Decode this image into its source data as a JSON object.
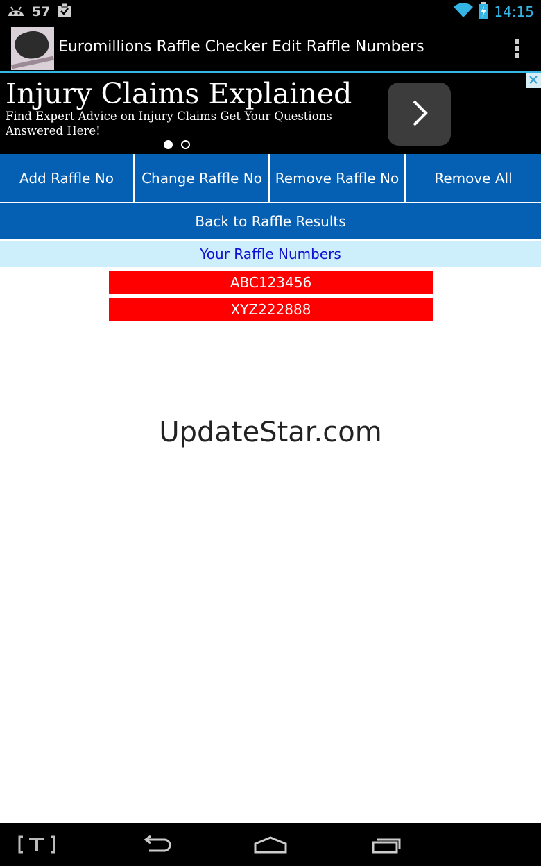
{
  "status_bar": {
    "notification_count": "57",
    "time": "14:15",
    "icons": [
      "android-icon",
      "clipboard-check-icon",
      "wifi-icon",
      "battery-charging-icon"
    ]
  },
  "action_bar": {
    "title": "Euromillions Raffle Checker Edit Raffle Numbers",
    "icon": "app-logo",
    "overflow_icon": "overflow-menu-icon"
  },
  "ad": {
    "headline": "Injury Claims Explained",
    "body": "Find Expert Advice on Injury Claims Get Your Questions Answered Here!",
    "cta_icon": "chevron-right-icon",
    "close_icon": "close-icon",
    "pages": 2,
    "active_page": 1
  },
  "toolbar": {
    "buttons": [
      {
        "label": "Add Raffle No"
      },
      {
        "label": "Change Raffle No"
      },
      {
        "label": "Remove Raffle No"
      },
      {
        "label": "Remove All"
      }
    ]
  },
  "back_label": "Back to Raffle Results",
  "section_title": "Your Raffle Numbers",
  "raffle_numbers": [
    "ABC123456",
    "XYZ222888"
  ],
  "watermark": "UpdateStar.com",
  "colors": {
    "accent_blue": "#0560b4",
    "holo_blue": "#33b5e5",
    "header_bg": "#cdeefb",
    "header_text": "#1010d0",
    "raffle_bg": "#ff0000"
  },
  "nav_bar": {
    "items": [
      "text-input-icon",
      "back-icon",
      "home-icon",
      "recent-apps-icon"
    ]
  }
}
